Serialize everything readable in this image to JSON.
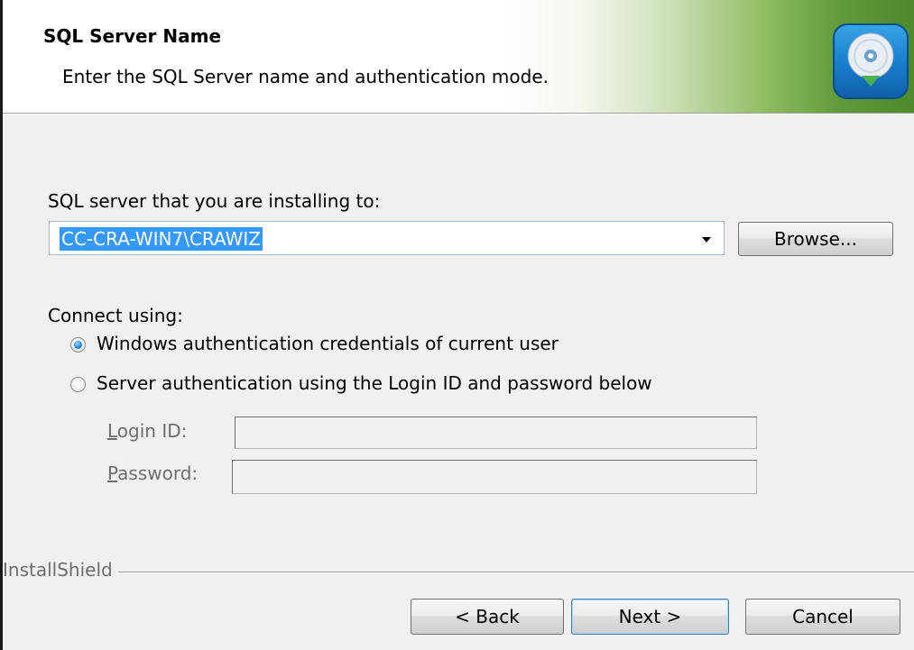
{
  "header": {
    "title": "SQL Server Name",
    "subtitle": "Enter the SQL Server name and authentication mode.",
    "logo_icon": "installer-disc-icon"
  },
  "server": {
    "label": "SQL server that you are installing to:",
    "value": "CC-CRA-WIN7\\CRAWIZ",
    "browse_label": "Browse..."
  },
  "connect": {
    "label": "Connect using:",
    "options": [
      {
        "label": "Windows authentication credentials of current user",
        "selected": true
      },
      {
        "label": "Server authentication using the Login ID and password below",
        "selected": false
      }
    ]
  },
  "credentials": {
    "login_first": "L",
    "login_rest": "ogin ID:",
    "login_value": "",
    "password_first": "P",
    "password_rest": "assword:",
    "password_value": ""
  },
  "footer": {
    "brand": "InstallShield",
    "back_label": "< Back",
    "next_label": "Next >",
    "cancel_label": "Cancel"
  },
  "colors": {
    "selection": "#3399ff",
    "header_gradient_end": "#4d8a2e",
    "logo_blue": "#1a7fcf"
  }
}
